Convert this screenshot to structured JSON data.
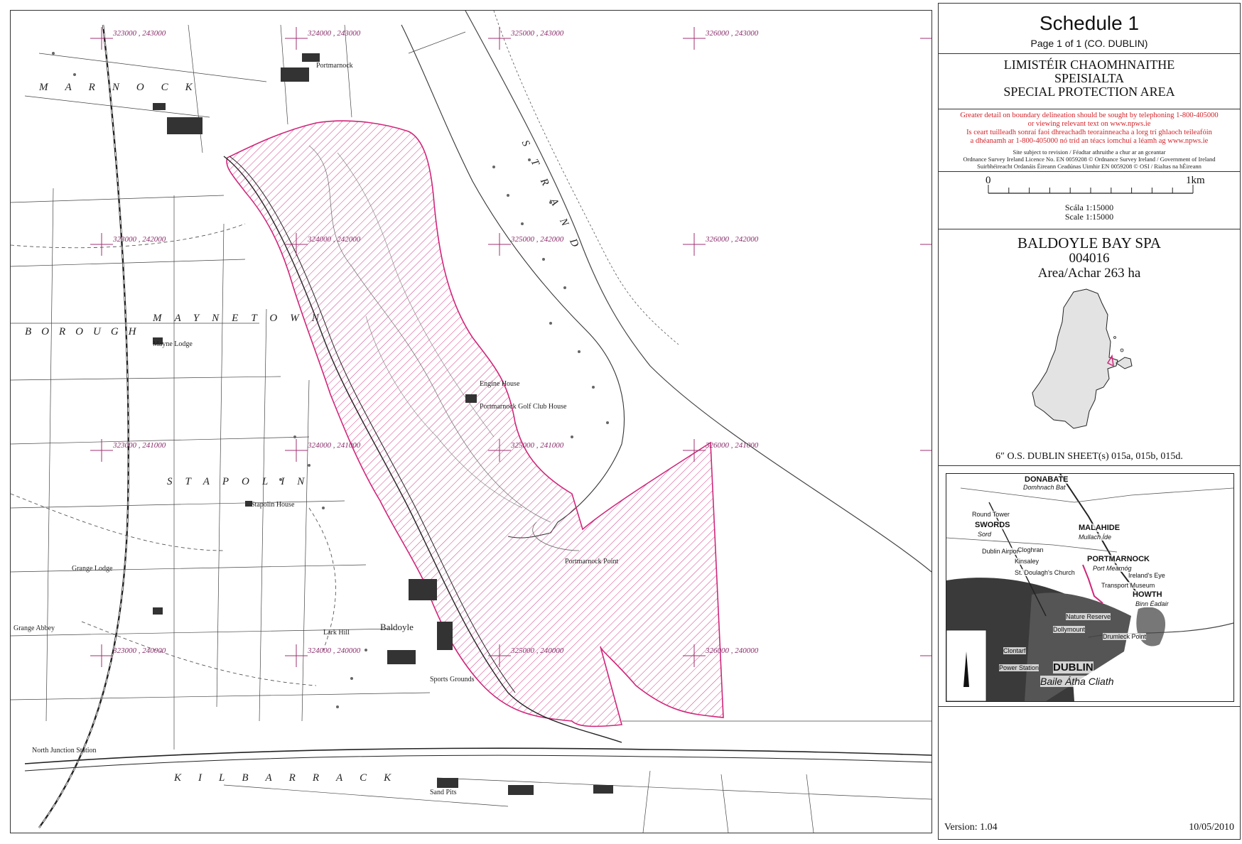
{
  "map": {
    "grid_labels": [
      "323000 , 243000",
      "324000 , 243000",
      "325000 , 243000",
      "326000 , 243000",
      "323000 , 242000",
      "324000 , 242000",
      "325000 , 242000",
      "326000 , 242000",
      "323000 , 241000",
      "324000 , 241000",
      "325000 , 241000",
      "326000 , 241000",
      "323000 , 240000",
      "324000 , 240000",
      "325000 , 240000",
      "326000 , 240000"
    ],
    "place_labels": {
      "portmarnock": "Portmarnock",
      "baldoyle": "Baldoyle",
      "portmarnock_point": "Portmarnock Point",
      "mayne_lodge": "Mayne Lodge",
      "stapolin_house": "Stapolin House",
      "engine_house": "Engine House",
      "golf_club_house": "Portmarnock Golf Club House",
      "lark_hill": "Lark Hill",
      "grange_abbey": "Grange Abbey",
      "grange_lodge": "Grange Lodge",
      "sports_grounds": "Sports Grounds",
      "sand_pits": "Sand Pits",
      "north_junction_station": "North Junction Station",
      "maynetown": "MAYNETOWN",
      "strand": "STRAND",
      "kilbarrack": "KILBARRACK",
      "stapolin": "STAPOLIN",
      "marnock": "MARNOCK",
      "borough": "BOROUGH"
    }
  },
  "panel": {
    "title": "Schedule 1",
    "page": "Page 1 of 1 (CO. DUBLIN)",
    "designation_ga_1": "LIMISTÉIR CHAOMHNAITHE",
    "designation_ga_2": "SPEISIALTA",
    "designation_en": "SPECIAL PROTECTION AREA",
    "notice_en_1": "Greater detail on boundary delineation should be sought by telephoning 1-800-405000",
    "notice_en_2": "or viewing relevant text on www.npws.ie",
    "notice_ga_1": "Is ceart tuilleadh sonraí faoi dhreachadh teorainneacha a lorg trí ghlaoch teileafóin",
    "notice_ga_2": "a dhéanamh ar 1-800-405000 nó tríd an téacs iomchuí a léamh ag www.npws.ie",
    "revision": "Site subject to revision / Féadtar athruithe a chur ar an gceantar",
    "licence_en": "Ordnance Survey Ireland Licence No. EN 0059208 © Ordnance Survey Ireland / Government of Ireland",
    "licence_ga": "Suirbhéireacht Ordanáis Éireann Ceadúnas Uimhir EN 0059208 © OSI / Rialtas na hÉireann",
    "scale_zero": "0",
    "scale_end": "1km",
    "scale_ga": "Scála 1:15000",
    "scale_en": "Scale 1:15000",
    "site_name": "BALDOYLE BAY SPA",
    "site_code": "004016",
    "site_area": "Area/Achar 263 ha",
    "sheets": "6″ O.S.  DUBLIN  SHEET(s) 015a, 015b, 015d.",
    "version": "Version: 1.04",
    "date": "10/05/2010"
  },
  "location_map": {
    "labels": {
      "donabate": "DONABATE",
      "domhnach_bat": "Domhnach Bat",
      "swords": "SWORDS",
      "sord": "Sord",
      "malahide": "MALAHIDE",
      "mullach_ide": "Mullach Íde",
      "portmarnock": "PORTMARNOCK",
      "port_mearnog": "Port Mearnóg",
      "howth": "HOWTH",
      "binn_eadair": "Binn Éadair",
      "irelands_eye": "Ireland's Eye",
      "dublin_airport": "Dublin Airport",
      "cloghran": "Cloghran",
      "kinsaley": "Kinsaley",
      "st_doulaghs": "St. Doulagh's Church",
      "nature_reserve": "Nature Reserve",
      "transport_museum": "Transport Museum",
      "dollymount": "Dollymount",
      "drumleck_point": "Drumleck Point",
      "clontarf": "Clontarf",
      "power_station": "Power Station",
      "dublin": "DUBLIN",
      "baile_atha_cliath": "Baile Átha Cliath",
      "round_tower": "Round Tower"
    }
  },
  "colors": {
    "boundary": "#d0267a",
    "grid": "#a0306f",
    "county_fill": "#e3e3e3"
  }
}
